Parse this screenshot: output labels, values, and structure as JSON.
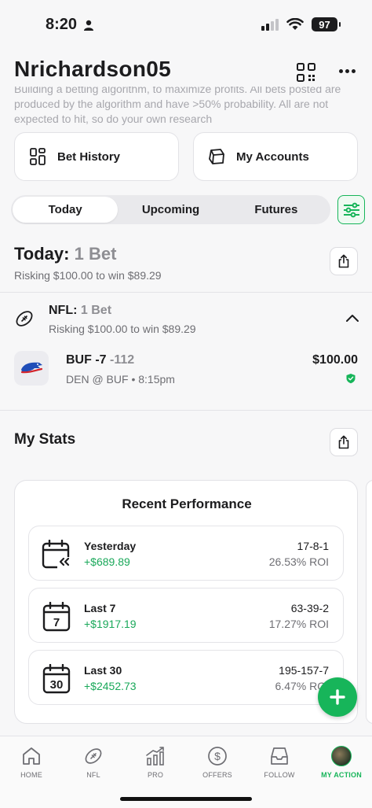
{
  "status_bar": {
    "time": "8:20",
    "battery": "97"
  },
  "header": {
    "title": "Nrichardson05"
  },
  "bio": {
    "line1": "Building a betting algorithm, to maximize profits. All bets posted are",
    "line2": "produced by the algorithm and have >50% probability. All are not",
    "line3": "expected to hit, so do your own research"
  },
  "quick_actions": {
    "bet_history": "Bet History",
    "my_accounts": "My Accounts"
  },
  "tabs": {
    "today": "Today",
    "upcoming": "Upcoming",
    "futures": "Futures",
    "active": "Today"
  },
  "today": {
    "label": "Today:",
    "count": "1 Bet",
    "summary": "Risking $100.00 to win $89.29"
  },
  "league": {
    "name": "NFL:",
    "count": "1 Bet",
    "summary": "Risking $100.00 to win $89.29"
  },
  "bet": {
    "pick": "BUF -7",
    "odds": "-112",
    "game": "DEN @ BUF • 8:15pm",
    "amount": "$100.00"
  },
  "stats": {
    "title": "My Stats",
    "card_title": "Recent Performance",
    "rows": [
      {
        "label": "Yesterday",
        "profit": "+$689.89",
        "record": "17-8-1",
        "roi": "26.53% ROI",
        "icon": "calendar-back-icon"
      },
      {
        "label": "Last 7",
        "profit": "+$1917.19",
        "record": "63-39-2",
        "roi": "17.27% ROI",
        "icon": "calendar-7-icon",
        "day": "7"
      },
      {
        "label": "Last 30",
        "profit": "+$2452.73",
        "record": "195-157-7",
        "roi": "6.47% ROI",
        "icon": "calendar-30-icon",
        "day": "30"
      }
    ]
  },
  "nav": {
    "home": "HOME",
    "nfl": "NFL",
    "pro": "PRO",
    "offers": "OFFERS",
    "follow": "FOLLOW",
    "my_action": "MY ACTION",
    "active": "MY ACTION"
  },
  "colors": {
    "accent": "#17b55a",
    "profit": "#1aa85a",
    "text": "#1c1c1e",
    "muted": "#8e8e93"
  }
}
